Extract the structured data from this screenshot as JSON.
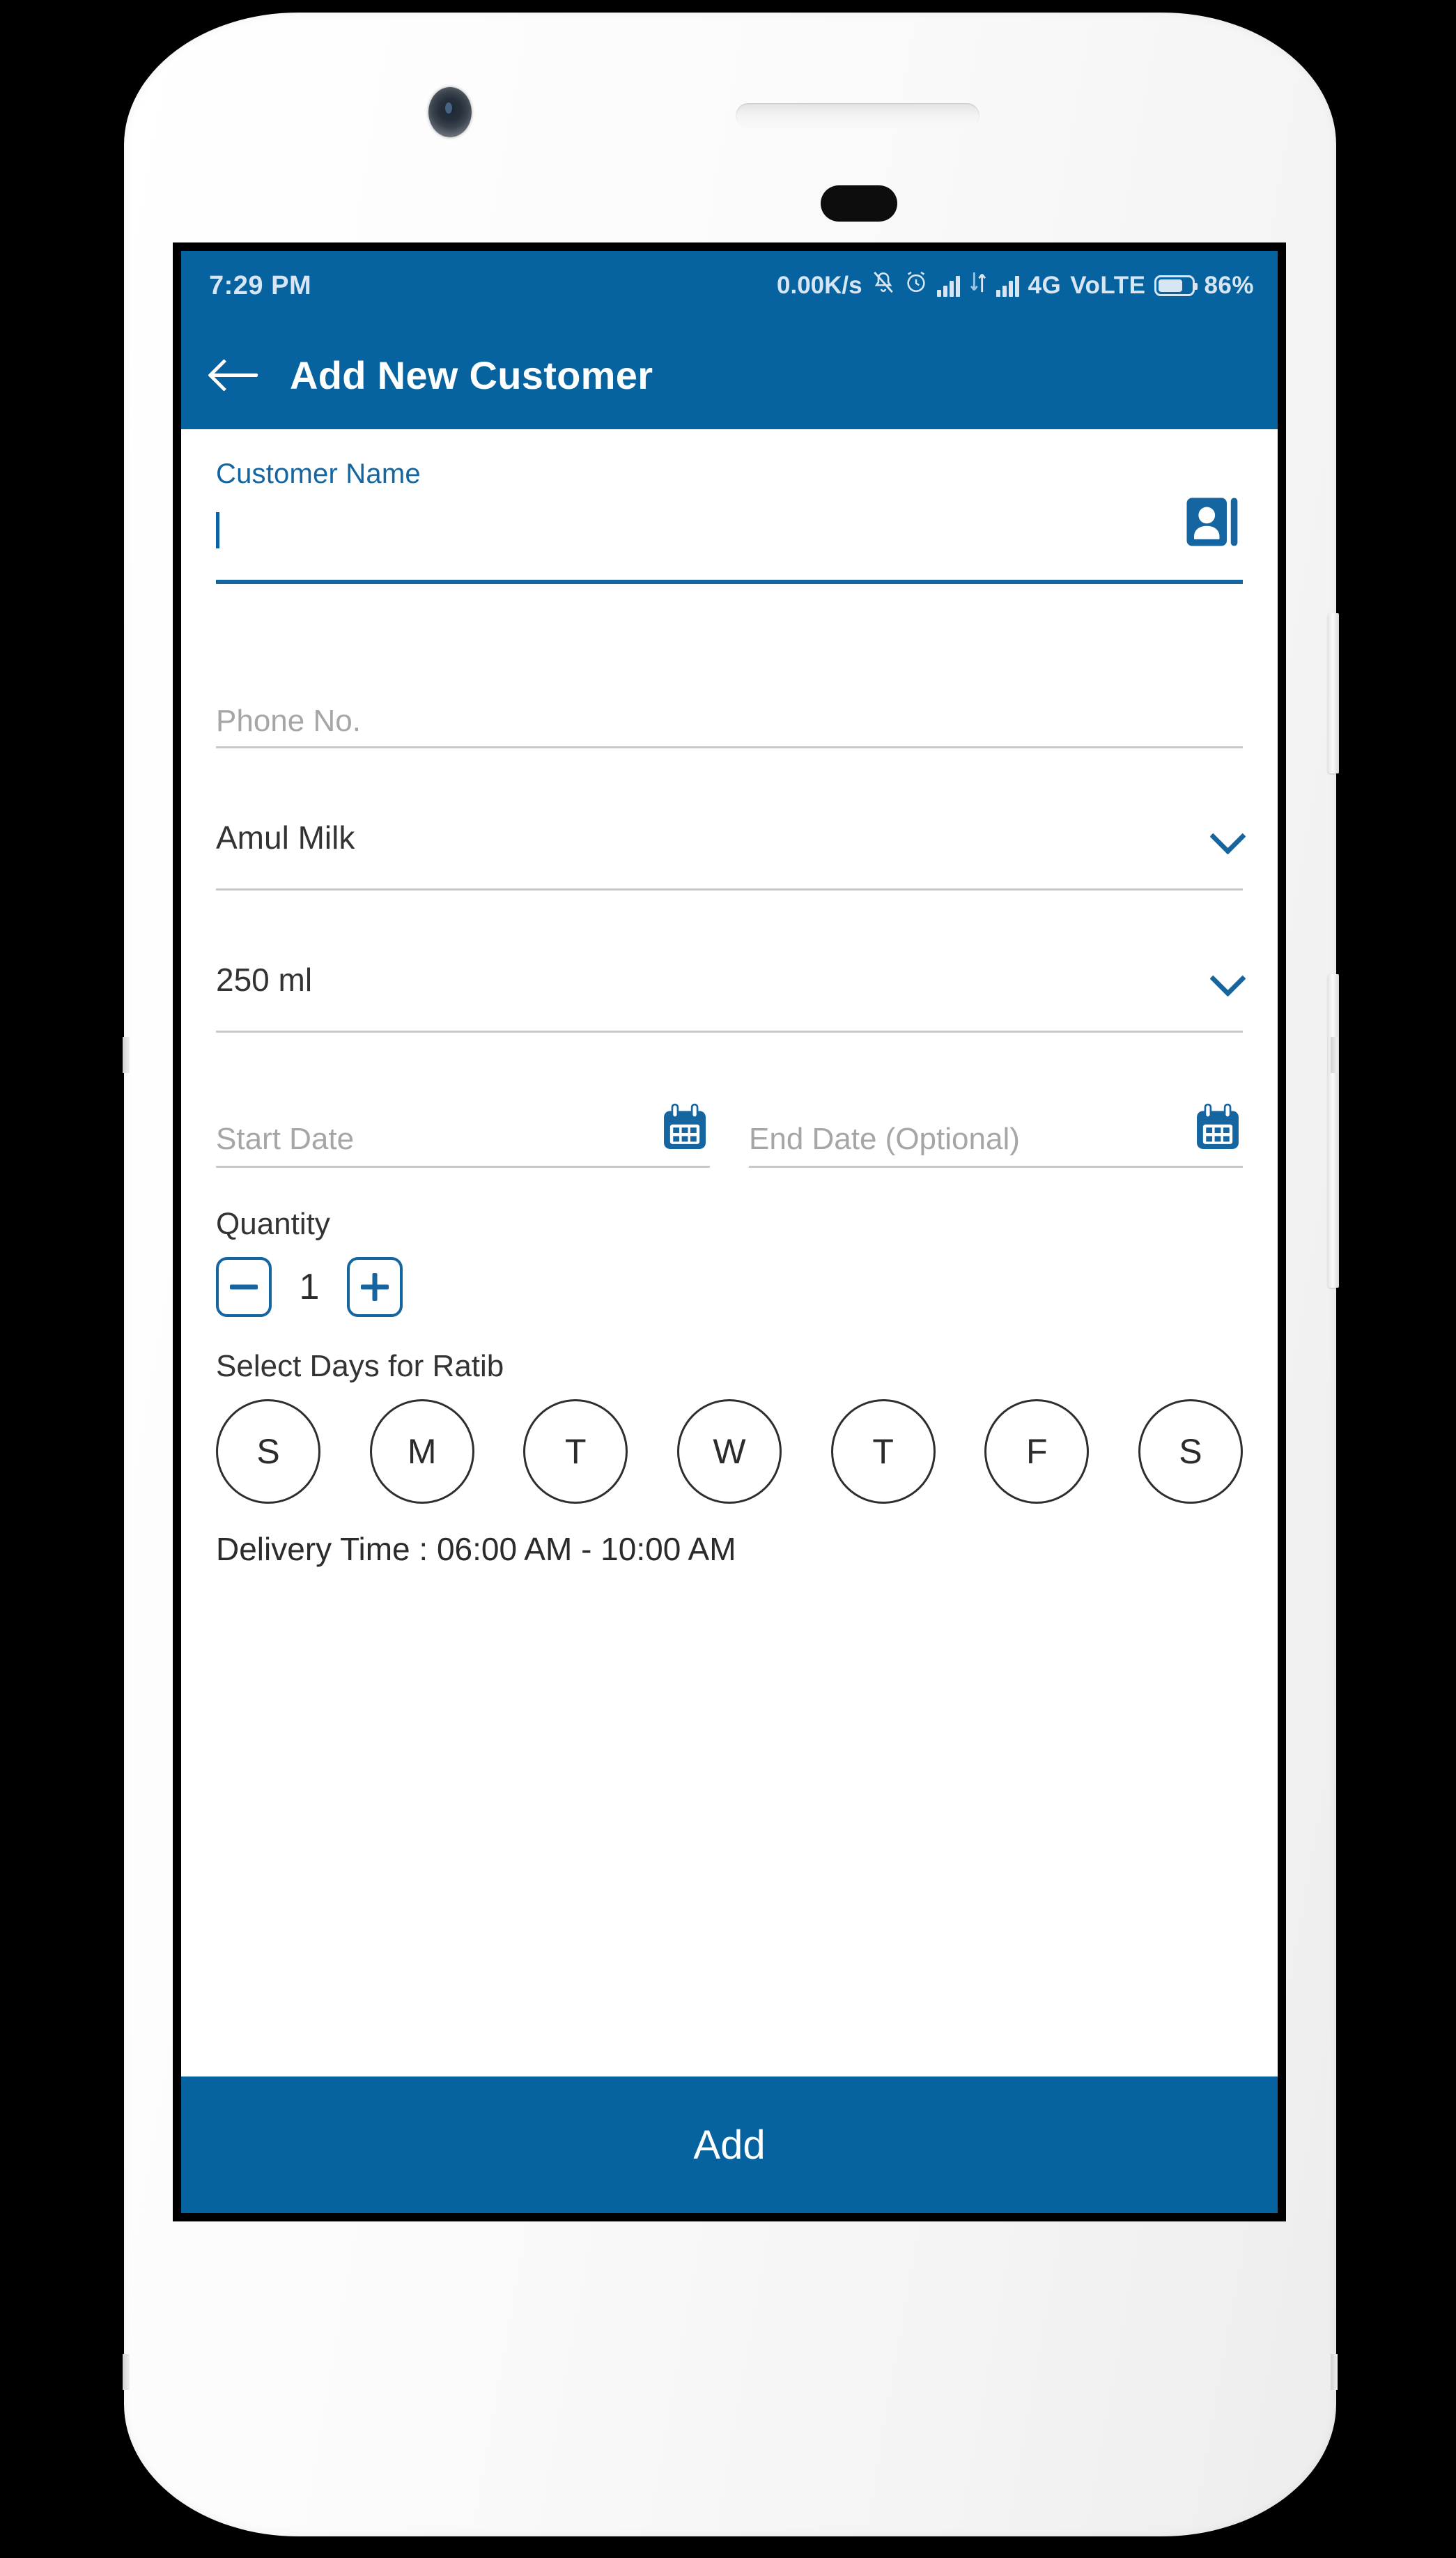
{
  "status_bar": {
    "time": "7:29 PM",
    "network_speed": "0.00K/s",
    "icons": [
      "mute-icon",
      "alarm-icon",
      "signal-bars-icon",
      "data-transfer-icon",
      "signal-bars-icon"
    ],
    "network_type": "4G",
    "volte": "VoLTE",
    "battery_percent": "86%"
  },
  "app_bar": {
    "back_label": "back-arrow",
    "title": "Add New Customer"
  },
  "form": {
    "customer_name": {
      "label": "Customer Name",
      "value": "",
      "contact_icon": "contacts-book-icon"
    },
    "phone": {
      "placeholder": "Phone No.",
      "value": ""
    },
    "product": {
      "value": "Amul Milk"
    },
    "size": {
      "value": "250 ml"
    },
    "start_date": {
      "placeholder": "Start Date",
      "value": ""
    },
    "end_date": {
      "placeholder": "End Date (Optional)",
      "value": ""
    },
    "quantity": {
      "label": "Quantity",
      "value": "1",
      "decrement": "−",
      "increment": "+"
    },
    "days": {
      "label": "Select Days for Ratib",
      "items": [
        {
          "label": "S",
          "selected": false
        },
        {
          "label": "M",
          "selected": false
        },
        {
          "label": "T",
          "selected": false
        },
        {
          "label": "W",
          "selected": false
        },
        {
          "label": "T",
          "selected": false
        },
        {
          "label": "F",
          "selected": false
        },
        {
          "label": "S",
          "selected": false
        }
      ]
    },
    "delivery_time": "Delivery Time : 06:00 AM - 10:00 AM"
  },
  "footer": {
    "add_label": "Add"
  },
  "colors": {
    "primary": "#06639f",
    "accent": "#1565a0",
    "placeholder": "#a6a6a6",
    "underline": "#c8c8c8",
    "text": "#2b2b2b"
  }
}
